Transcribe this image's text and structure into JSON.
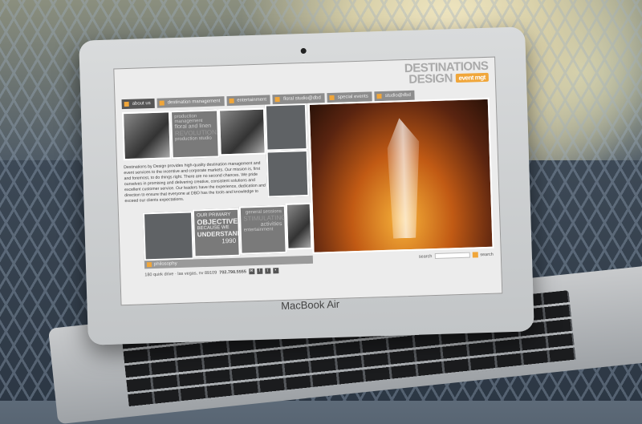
{
  "device": {
    "brand": "MacBook Air"
  },
  "site": {
    "logo": {
      "line1": "DESTINATIONS",
      "line2": "DESIGN",
      "tag": "event mgt"
    },
    "nav": [
      "about us",
      "destination management",
      "entertainment",
      "floral studio@dbd",
      "special events",
      "studio@dbd"
    ],
    "tiles": {
      "t1": [
        "production management",
        "floral and linen",
        "REVOLUTIONARY",
        "production studio"
      ],
      "t2": [
        "OUR PRIMARY",
        "OBJECTIVE",
        "BECAUSE WE",
        "UNDERSTAND",
        "1990"
      ],
      "t3": [
        "general sessions",
        "STIMULATING",
        "activities",
        "entertainment"
      ]
    },
    "about": "Destinations by Design provides high-quality destination management and event services to the incentive and corporate markets. Our mission is, first and foremost, to do things right. There are no second chances. We pride ourselves in promising and delivering creative, consistent solutions and excellent customer service. Our leaders have the experience, dedication and direction to ensure that everyone at DBD has the tools and knowledge to exceed our clients expectations.",
    "bar_label": "philosophy",
    "footer": {
      "address": "180 quirk drive · las vegas, nv 89109",
      "phone": "702.798.5555"
    },
    "search": {
      "label": "search",
      "button": "search"
    }
  }
}
